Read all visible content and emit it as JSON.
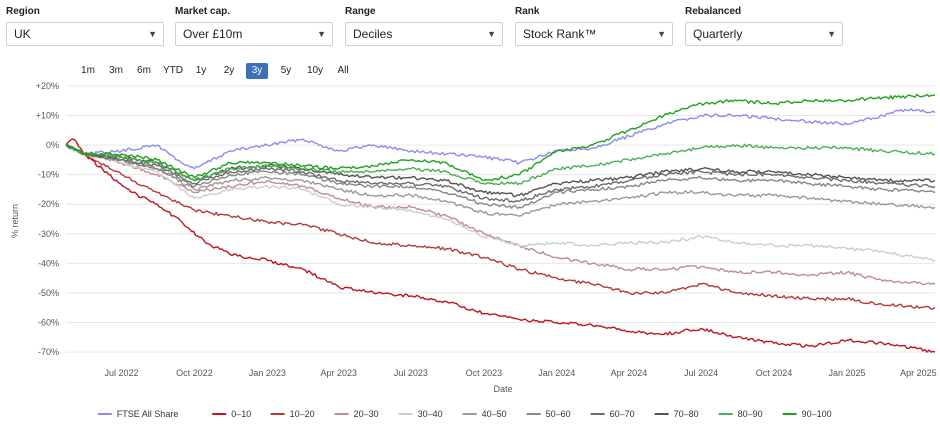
{
  "filters": [
    {
      "label": "Region",
      "value": "UK"
    },
    {
      "label": "Market cap.",
      "value": "Over £10m"
    },
    {
      "label": "Range",
      "value": "Deciles"
    },
    {
      "label": "Rank",
      "value": "Stock Rank™"
    },
    {
      "label": "Rebalanced",
      "value": "Quarterly"
    }
  ],
  "ranges": [
    "1m",
    "3m",
    "6m",
    "YTD",
    "1y",
    "2y",
    "3y",
    "5y",
    "10y",
    "All"
  ],
  "active_range": "3y",
  "icons": {
    "dropdown": "chevron-down-icon"
  },
  "chart_data": {
    "type": "line",
    "title": "",
    "xlabel": "Date",
    "ylabel": "% return",
    "ylim": [
      -72,
      22
    ],
    "yticks": [
      20,
      10,
      0,
      -10,
      -20,
      -30,
      -40,
      -50,
      -60,
      -70
    ],
    "ytick_labels": [
      "+20%",
      "+10%",
      "0%",
      "-10%",
      "-20%",
      "-30%",
      "-40%",
      "-50%",
      "-60%",
      "-70%"
    ],
    "xlim": [
      "2022-04-22",
      "2025-04-22"
    ],
    "xtick_dates": [
      "2022-07-01",
      "2022-10-01",
      "2023-01-01",
      "2023-04-01",
      "2023-07-01",
      "2023-10-01",
      "2024-01-01",
      "2024-04-01",
      "2024-07-01",
      "2024-10-01",
      "2025-01-01",
      "2025-04-01"
    ],
    "xtick_labels": [
      "Jul 2022",
      "Oct 2022",
      "Jan 2023",
      "Apr 2023",
      "Jul 2023",
      "Oct 2023",
      "Jan 2024",
      "Apr 2024",
      "Jul 2024",
      "Oct 2024",
      "Jan 2025",
      "Apr 2025"
    ],
    "grid": "horizontal",
    "legend_position": "bottom",
    "series": [
      {
        "name": "FTSE All Share",
        "color": "#8c8cf0",
        "x": [
          "2022-04-22",
          "2022-05-15",
          "2022-07-01",
          "2022-08-15",
          "2022-09-15",
          "2022-10-01",
          "2022-11-15",
          "2023-01-01",
          "2023-02-15",
          "2023-04-01",
          "2023-05-15",
          "2023-07-01",
          "2023-08-15",
          "2023-10-01",
          "2023-11-15",
          "2024-01-01",
          "2024-02-15",
          "2024-04-01",
          "2024-05-15",
          "2024-07-01",
          "2024-08-15",
          "2024-10-01",
          "2024-11-15",
          "2025-01-01",
          "2025-02-15",
          "2025-03-15",
          "2025-04-22"
        ],
        "y": [
          0,
          -3,
          -2,
          0,
          -6,
          -8,
          -2,
          0,
          2,
          -2,
          0,
          -2,
          -3,
          -4,
          -6,
          -2,
          -1,
          3,
          7,
          10,
          10,
          9,
          8,
          7,
          10,
          12,
          11
        ]
      },
      {
        "name": "0–10",
        "color": "#c0151f",
        "x": [
          "2022-04-22",
          "2022-05-01",
          "2022-05-15",
          "2022-06-15",
          "2022-07-15",
          "2022-08-15",
          "2022-09-15",
          "2022-10-15",
          "2022-11-15",
          "2023-01-01",
          "2023-02-15",
          "2023-04-01",
          "2023-05-15",
          "2023-07-01",
          "2023-08-15",
          "2023-10-01",
          "2023-11-15",
          "2024-01-01",
          "2024-02-15",
          "2024-04-01",
          "2024-05-15",
          "2024-07-01",
          "2024-08-15",
          "2024-10-01",
          "2024-11-15",
          "2025-01-01",
          "2025-02-15",
          "2025-04-22"
        ],
        "y": [
          0,
          2,
          -3,
          -10,
          -16,
          -20,
          -26,
          -33,
          -37,
          -39,
          -42,
          -48,
          -50,
          -51,
          -53,
          -57,
          -59,
          -60,
          -61,
          -63,
          -64,
          -62,
          -65,
          -67,
          -68,
          -66,
          -67,
          -70
        ]
      },
      {
        "name": "10–20",
        "color": "#b23a3a",
        "x": [
          "2022-04-22",
          "2022-05-15",
          "2022-07-01",
          "2022-08-15",
          "2022-10-01",
          "2022-11-15",
          "2023-01-01",
          "2023-02-15",
          "2023-04-01",
          "2023-05-15",
          "2023-07-01",
          "2023-08-15",
          "2023-10-01",
          "2023-11-15",
          "2024-01-01",
          "2024-02-15",
          "2024-04-01",
          "2024-05-15",
          "2024-07-01",
          "2024-08-15",
          "2024-10-01",
          "2024-11-15",
          "2025-01-01",
          "2025-02-15",
          "2025-04-22"
        ],
        "y": [
          0,
          -3,
          -10,
          -16,
          -22,
          -24,
          -26,
          -27,
          -30,
          -33,
          -34,
          -35,
          -38,
          -42,
          -45,
          -47,
          -50,
          -50,
          -47,
          -50,
          -51,
          -52,
          -52,
          -54,
          -55
        ]
      },
      {
        "name": "20–30",
        "color": "#bf8d8d",
        "x": [
          "2022-04-22",
          "2022-05-15",
          "2022-07-01",
          "2022-08-15",
          "2022-10-01",
          "2022-11-15",
          "2023-01-01",
          "2023-02-15",
          "2023-04-01",
          "2023-05-15",
          "2023-07-01",
          "2023-08-15",
          "2023-10-01",
          "2023-11-15",
          "2024-01-01",
          "2024-02-15",
          "2024-04-01",
          "2024-05-15",
          "2024-07-01",
          "2024-08-15",
          "2024-10-01",
          "2024-11-15",
          "2025-01-01",
          "2025-02-15",
          "2025-04-22"
        ],
        "y": [
          0,
          -3,
          -6,
          -10,
          -16,
          -14,
          -12,
          -14,
          -18,
          -21,
          -21,
          -24,
          -30,
          -34,
          -38,
          -40,
          -42,
          -42,
          -41,
          -43,
          -43,
          -44,
          -43,
          -46,
          -47
        ]
      },
      {
        "name": "30–40",
        "color": "#cdcdcd",
        "x": [
          "2022-04-22",
          "2022-05-15",
          "2022-07-01",
          "2022-08-15",
          "2022-10-01",
          "2022-11-15",
          "2023-01-01",
          "2023-02-15",
          "2023-04-01",
          "2023-05-15",
          "2023-07-01",
          "2023-08-15",
          "2023-10-01",
          "2023-11-15",
          "2024-01-01",
          "2024-02-15",
          "2024-04-01",
          "2024-05-15",
          "2024-07-01",
          "2024-08-15",
          "2024-10-01",
          "2024-11-15",
          "2025-01-01",
          "2025-02-15",
          "2025-04-22"
        ],
        "y": [
          0,
          -3,
          -6,
          -9,
          -18,
          -15,
          -14,
          -15,
          -20,
          -21,
          -22,
          -25,
          -31,
          -34,
          -33,
          -34,
          -33,
          -33,
          -31,
          -33,
          -34,
          -34,
          -35,
          -36,
          -39
        ]
      },
      {
        "name": "40–50",
        "color": "#9a9a9a",
        "x": [
          "2022-04-22",
          "2022-05-15",
          "2022-07-01",
          "2022-08-15",
          "2022-10-01",
          "2022-11-15",
          "2023-01-01",
          "2023-02-15",
          "2023-04-01",
          "2023-05-15",
          "2023-07-01",
          "2023-08-15",
          "2023-10-01",
          "2023-11-15",
          "2024-01-01",
          "2024-02-15",
          "2024-04-01",
          "2024-05-15",
          "2024-07-01",
          "2024-08-15",
          "2024-10-01",
          "2024-11-15",
          "2025-01-01",
          "2025-02-15",
          "2025-04-22"
        ],
        "y": [
          0,
          -3,
          -5,
          -8,
          -15,
          -12,
          -11,
          -12,
          -15,
          -17,
          -17,
          -19,
          -23,
          -24,
          -20,
          -19,
          -18,
          -16,
          -16,
          -17,
          -17,
          -18,
          -19,
          -20,
          -21
        ]
      },
      {
        "name": "50–60",
        "color": "#878787",
        "x": [
          "2022-04-22",
          "2022-05-15",
          "2022-07-01",
          "2022-08-15",
          "2022-10-01",
          "2022-11-15",
          "2023-01-01",
          "2023-02-15",
          "2023-04-01",
          "2023-05-15",
          "2023-07-01",
          "2023-08-15",
          "2023-10-01",
          "2023-11-15",
          "2024-01-01",
          "2024-02-15",
          "2024-04-01",
          "2024-05-15",
          "2024-07-01",
          "2024-08-15",
          "2024-10-01",
          "2024-11-15",
          "2025-01-01",
          "2025-02-15",
          "2025-04-22"
        ],
        "y": [
          0,
          -3,
          -5,
          -8,
          -14,
          -10,
          -9,
          -10,
          -13,
          -14,
          -14,
          -16,
          -20,
          -21,
          -16,
          -15,
          -14,
          -12,
          -11,
          -12,
          -12,
          -13,
          -14,
          -15,
          -16
        ]
      },
      {
        "name": "60–70",
        "color": "#6d6d6d",
        "x": [
          "2022-04-22",
          "2022-05-15",
          "2022-07-01",
          "2022-08-15",
          "2022-10-01",
          "2022-11-15",
          "2023-01-01",
          "2023-02-15",
          "2023-04-01",
          "2023-05-15",
          "2023-07-01",
          "2023-08-15",
          "2023-10-01",
          "2023-11-15",
          "2024-01-01",
          "2024-02-15",
          "2024-04-01",
          "2024-05-15",
          "2024-07-01",
          "2024-08-15",
          "2024-10-01",
          "2024-11-15",
          "2025-01-01",
          "2025-02-15",
          "2025-04-22"
        ],
        "y": [
          0,
          -3,
          -5,
          -7,
          -13,
          -9,
          -8,
          -9,
          -12,
          -13,
          -13,
          -14,
          -18,
          -19,
          -15,
          -14,
          -12,
          -10,
          -9,
          -10,
          -10,
          -11,
          -12,
          -13,
          -14
        ]
      },
      {
        "name": "70–80",
        "color": "#555555",
        "x": [
          "2022-04-22",
          "2022-05-15",
          "2022-07-01",
          "2022-08-15",
          "2022-10-01",
          "2022-11-15",
          "2023-01-01",
          "2023-02-15",
          "2023-04-01",
          "2023-05-15",
          "2023-07-01",
          "2023-08-15",
          "2023-10-01",
          "2023-11-15",
          "2024-01-01",
          "2024-02-15",
          "2024-04-01",
          "2024-05-15",
          "2024-07-01",
          "2024-08-15",
          "2024-10-01",
          "2024-11-15",
          "2025-01-01",
          "2025-02-15",
          "2025-04-22"
        ],
        "y": [
          0,
          -3,
          -4,
          -6,
          -12,
          -8,
          -7,
          -8,
          -10,
          -11,
          -11,
          -12,
          -16,
          -17,
          -13,
          -12,
          -11,
          -9,
          -8,
          -9,
          -9,
          -10,
          -11,
          -12,
          -12
        ]
      },
      {
        "name": "80–90",
        "color": "#4caf50",
        "x": [
          "2022-04-22",
          "2022-05-15",
          "2022-07-01",
          "2022-08-15",
          "2022-10-01",
          "2022-11-15",
          "2023-01-01",
          "2023-02-15",
          "2023-04-01",
          "2023-05-15",
          "2023-07-01",
          "2023-08-15",
          "2023-10-01",
          "2023-11-15",
          "2024-01-01",
          "2024-02-15",
          "2024-04-01",
          "2024-05-15",
          "2024-07-01",
          "2024-08-15",
          "2024-10-01",
          "2024-11-15",
          "2025-01-01",
          "2025-02-15",
          "2025-04-22"
        ],
        "y": [
          0,
          -3,
          -4,
          -6,
          -12,
          -8,
          -7,
          -8,
          -9,
          -9,
          -8,
          -9,
          -13,
          -13,
          -8,
          -7,
          -5,
          -3,
          -1,
          0,
          -1,
          -1,
          -1,
          -2,
          -3
        ]
      },
      {
        "name": "90–100",
        "color": "#22a01e",
        "x": [
          "2022-04-22",
          "2022-05-15",
          "2022-07-01",
          "2022-08-15",
          "2022-10-01",
          "2022-11-15",
          "2023-01-01",
          "2023-02-15",
          "2023-04-01",
          "2023-05-15",
          "2023-07-01",
          "2023-08-15",
          "2023-10-01",
          "2023-11-15",
          "2024-01-01",
          "2024-02-15",
          "2024-04-01",
          "2024-05-15",
          "2024-07-01",
          "2024-08-15",
          "2024-10-01",
          "2024-11-15",
          "2025-01-01",
          "2025-02-15",
          "2025-04-22"
        ],
        "y": [
          0,
          -3,
          -3,
          -5,
          -11,
          -6,
          -6,
          -7,
          -8,
          -7,
          -5,
          -6,
          -12,
          -10,
          -2,
          0,
          5,
          10,
          14,
          15,
          14,
          15,
          15,
          16,
          17
        ]
      }
    ]
  }
}
